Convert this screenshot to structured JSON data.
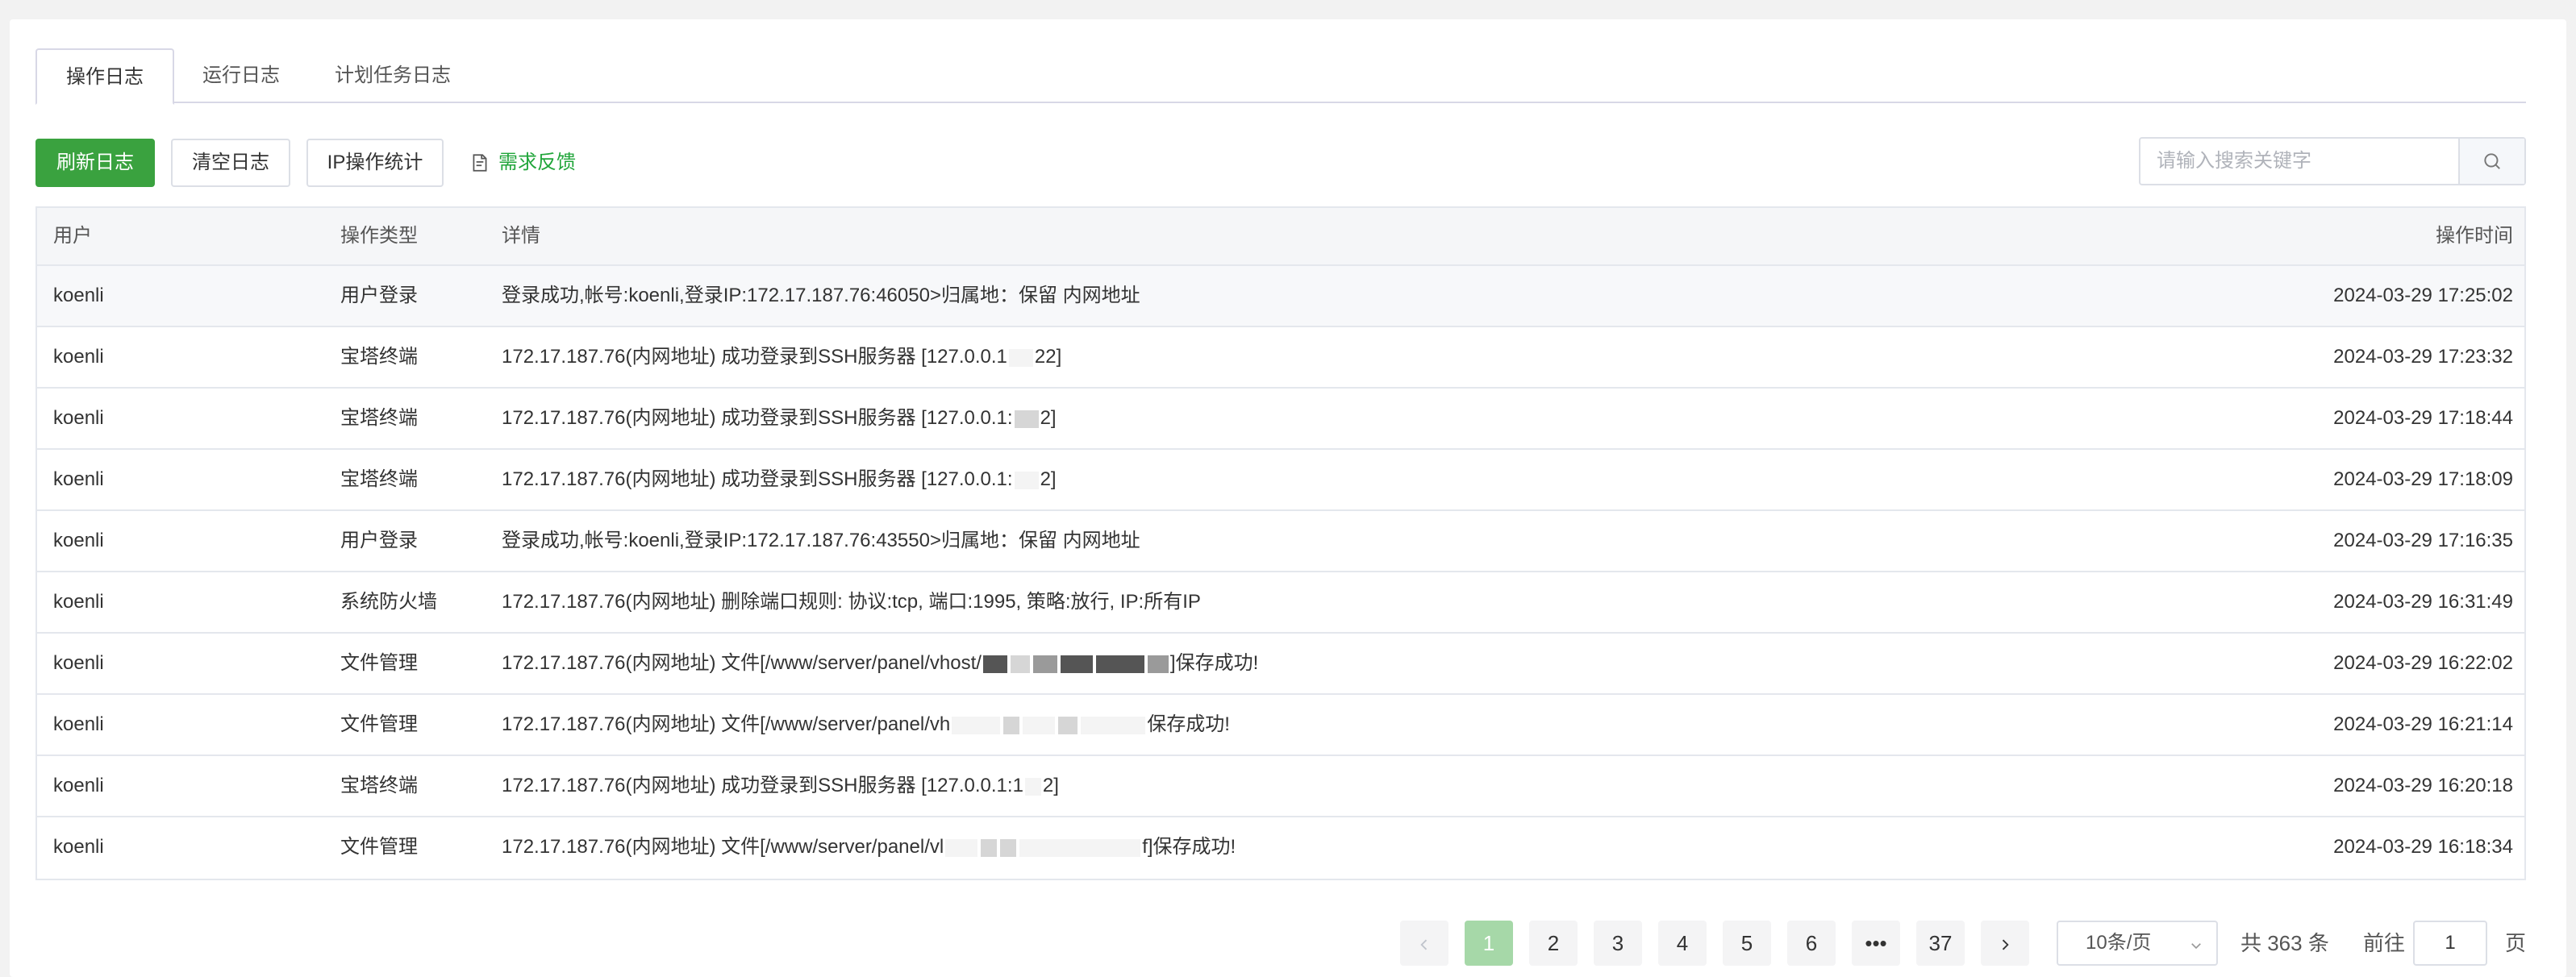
{
  "tabs": [
    {
      "label": "操作日志",
      "active": true
    },
    {
      "label": "运行日志",
      "active": false
    },
    {
      "label": "计划任务日志",
      "active": false
    }
  ],
  "toolbar": {
    "refresh_label": "刷新日志",
    "clear_label": "清空日志",
    "ip_stats_label": "IP操作统计",
    "feedback_label": "需求反馈",
    "search_placeholder": "请输入搜索关键字"
  },
  "table": {
    "headers": {
      "user": "用户",
      "type": "操作类型",
      "detail": "详情",
      "time": "操作时间"
    },
    "rows": [
      {
        "user": "koenli",
        "type": "用户登录",
        "detail": "登录成功,帐号:koenli,登录IP:172.17.187.76:46050>归属地：保留 内网地址",
        "detail_tail": "",
        "time": "2024-03-29 17:25:02"
      },
      {
        "user": "koenli",
        "type": "宝塔终端",
        "detail": "172.17.187.76(内网地址) 成功登录到SSH服务器 [127.0.0.1",
        "detail_tail": "22]",
        "time": "2024-03-29 17:23:32"
      },
      {
        "user": "koenli",
        "type": "宝塔终端",
        "detail": "172.17.187.76(内网地址) 成功登录到SSH服务器 [127.0.0.1:",
        "detail_tail": "2]",
        "time": "2024-03-29 17:18:44"
      },
      {
        "user": "koenli",
        "type": "宝塔终端",
        "detail": "172.17.187.76(内网地址) 成功登录到SSH服务器 [127.0.0.1:",
        "detail_tail": "2]",
        "time": "2024-03-29 17:18:09"
      },
      {
        "user": "koenli",
        "type": "用户登录",
        "detail": "登录成功,帐号:koenli,登录IP:172.17.187.76:43550>归属地：保留 内网地址",
        "detail_tail": "",
        "time": "2024-03-29 17:16:35"
      },
      {
        "user": "koenli",
        "type": "系统防火墙",
        "detail": "172.17.187.76(内网地址) 删除端口规则: 协议:tcp, 端口:1995, 策略:放行, IP:所有IP",
        "detail_tail": "",
        "time": "2024-03-29 16:31:49"
      },
      {
        "user": "koenli",
        "type": "文件管理",
        "detail": "172.17.187.76(内网地址) 文件[/www/server/panel/vhost/",
        "detail_tail": "]保存成功!",
        "time": "2024-03-29 16:22:02"
      },
      {
        "user": "koenli",
        "type": "文件管理",
        "detail": "172.17.187.76(内网地址) 文件[/www/server/panel/vh",
        "detail_tail": "保存成功!",
        "time": "2024-03-29 16:21:14"
      },
      {
        "user": "koenli",
        "type": "宝塔终端",
        "detail": "172.17.187.76(内网地址) 成功登录到SSH服务器 [127.0.0.1:1",
        "detail_tail": "2]",
        "time": "2024-03-29 16:20:18"
      },
      {
        "user": "koenli",
        "type": "文件管理",
        "detail": "172.17.187.76(内网地址) 文件[/www/server/panel/vl",
        "detail_tail": "f]保存成功!",
        "time": "2024-03-29 16:18:34"
      }
    ]
  },
  "pagination": {
    "pages": [
      "1",
      "2",
      "3",
      "4",
      "5",
      "6",
      "•••",
      "37"
    ],
    "current": "1",
    "page_size": "10条/页",
    "total_text": "共 363 条",
    "goto_prefix": "前往",
    "goto_value": "1",
    "goto_suffix": "页"
  },
  "colors": {
    "primary": "#20a53a",
    "active_page": "#a6d8a8"
  }
}
